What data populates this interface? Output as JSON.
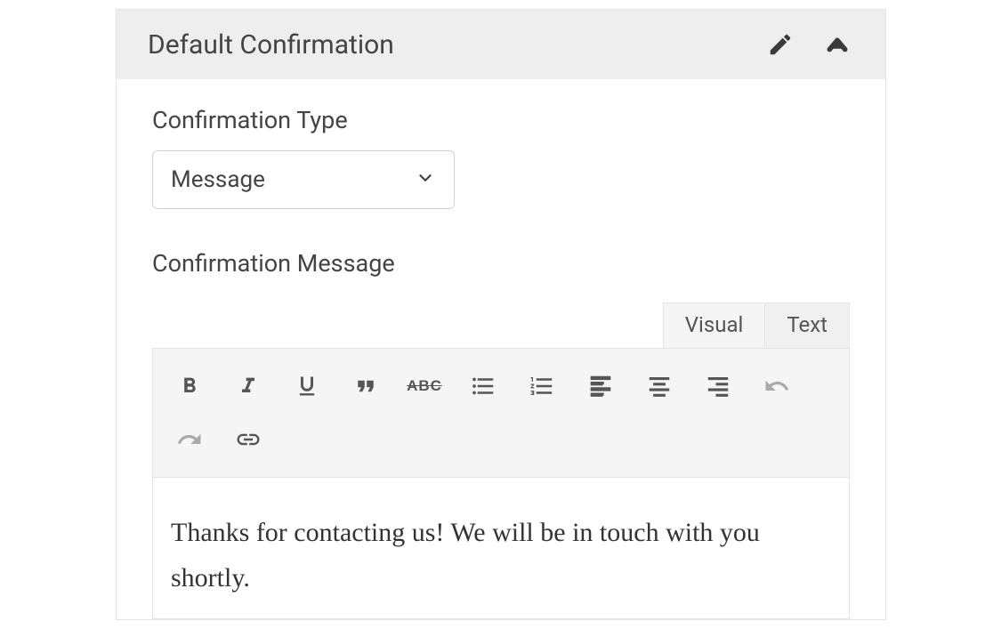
{
  "header": {
    "title": "Default Confirmation"
  },
  "fields": {
    "type_label": "Confirmation Type",
    "type_value": "Message",
    "message_label": "Confirmation Message"
  },
  "editor": {
    "tabs": {
      "visual": "Visual",
      "text": "Text",
      "active": "visual"
    },
    "content": "Thanks for contacting us! We will be in touch with you shortly.",
    "toolbar": {
      "bold": "B",
      "italic": "I",
      "underline": "U",
      "strikethrough": "ABC"
    }
  }
}
